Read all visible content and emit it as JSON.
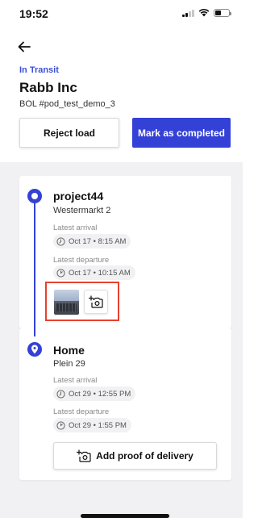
{
  "status_bar": {
    "time": "19:52",
    "icons": [
      "signal-icon",
      "wifi-icon",
      "battery-icon"
    ]
  },
  "header": {
    "back_icon": "arrow-left-icon"
  },
  "shipment": {
    "status": "In Transit",
    "company": "Rabb Inc",
    "bol": "BOL #pod_test_demo_3"
  },
  "actions": {
    "reject_label": "Reject load",
    "complete_label": "Mark as completed"
  },
  "stops": [
    {
      "name": "project44",
      "address": "Westermarkt 2",
      "arrival_label": "Latest arrival",
      "arrival_value": "Oct 17 • 8:15 AM",
      "departure_label": "Latest departure",
      "departure_value": "Oct 17 • 10:15 AM",
      "marker_icon": "circle-dot-icon",
      "photos": [
        "keyboard-photo"
      ],
      "add_photo_icon": "add-photo-icon"
    },
    {
      "name": "Home",
      "address": "Plein 29",
      "arrival_label": "Latest arrival",
      "arrival_value": "Oct 29 • 12:55 PM",
      "departure_label": "Latest departure",
      "departure_value": "Oct 29 • 1:55 PM",
      "marker_icon": "location-pin-icon",
      "pod_button_label": "Add proof of delivery",
      "add_photo_icon": "add-photo-icon"
    }
  ],
  "colors": {
    "accent": "#3441d6",
    "status_text": "#3b4fd8",
    "highlight": "#e8412e",
    "background_alt": "#f1f1f4"
  }
}
